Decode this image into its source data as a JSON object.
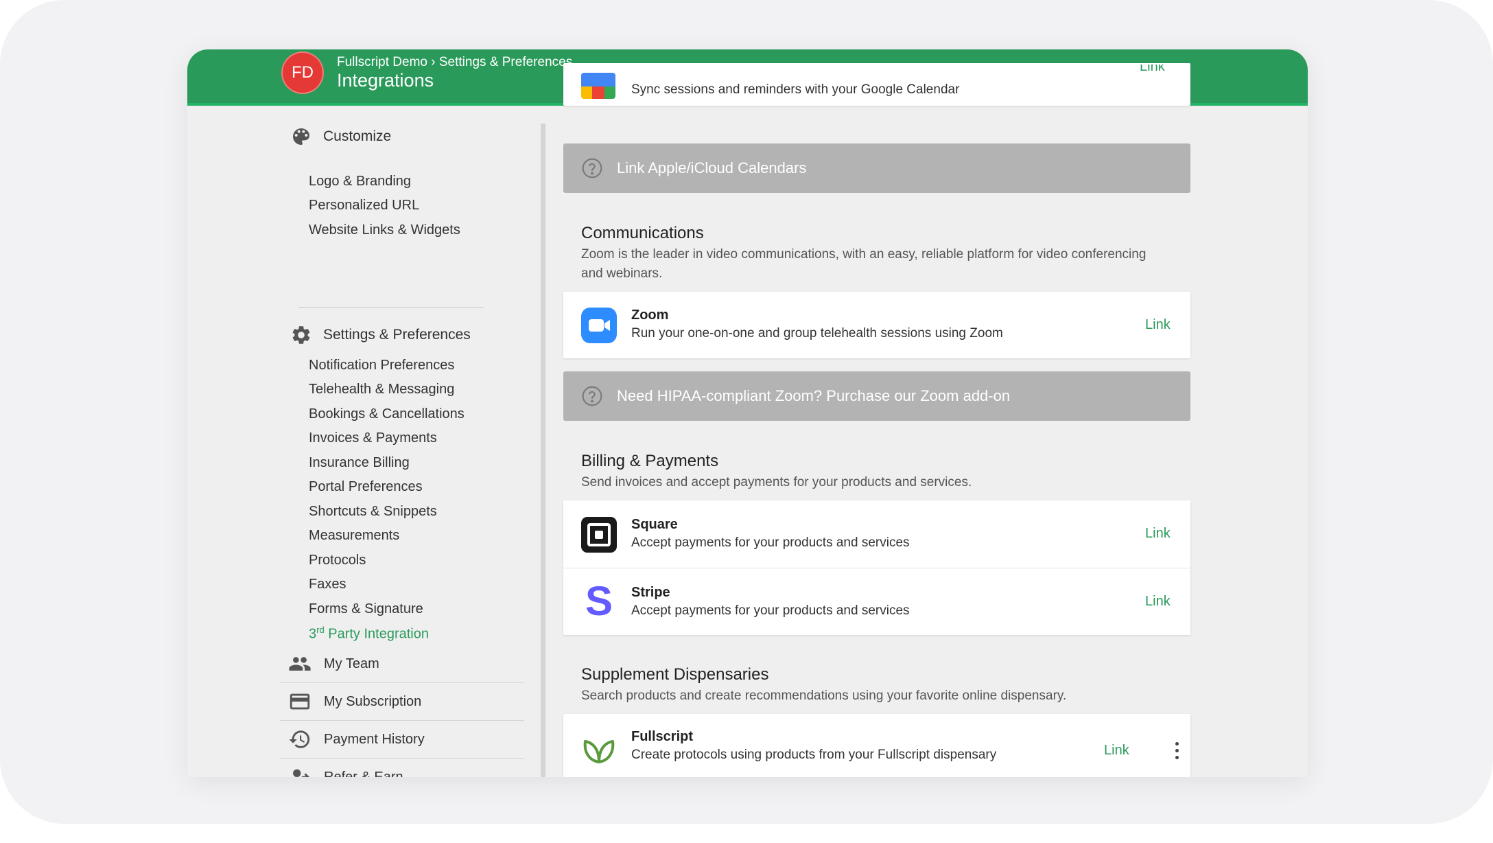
{
  "header": {
    "avatar_initials": "FD",
    "breadcrumb_org": "Fullscript Demo",
    "breadcrumb_sep": " › ",
    "breadcrumb_section": "Settings & Preferences",
    "title": "Integrations"
  },
  "sidebar": {
    "customize": {
      "label": "Customize",
      "items": [
        "Logo & Branding",
        "Personalized URL",
        "Website Links & Widgets"
      ]
    },
    "settings": {
      "label": "Settings & Preferences",
      "items": [
        "Notification Preferences",
        "Telehealth & Messaging",
        "Bookings & Cancellations",
        "Invoices & Payments",
        "Insurance Billing",
        "Portal Preferences",
        "Shortcuts & Snippets",
        "Measurements",
        "Protocols",
        "Faxes",
        "Forms & Signature"
      ],
      "active_prefix": "3",
      "active_sup": "rd",
      "active_rest": " Party Integration"
    },
    "bottom": {
      "team": "My Team",
      "subscription": "My Subscription",
      "payment_history": "Payment History",
      "refer": "Refer & Earn"
    }
  },
  "main": {
    "google": {
      "desc": "Sync sessions and reminders with your Google Calendar",
      "link": "Link"
    },
    "apple_banner": "Link Apple/iCloud Calendars",
    "communications": {
      "title": "Communications",
      "desc": "Zoom is the leader in video communications, with an easy, reliable platform for video conferencing and webinars."
    },
    "zoom": {
      "name": "Zoom",
      "desc": "Run your one-on-one and group telehealth sessions using Zoom",
      "link": "Link"
    },
    "hipaa_banner": "Need HIPAA-compliant Zoom? Purchase our Zoom add-on",
    "billing": {
      "title": "Billing & Payments",
      "desc": "Send invoices and accept payments for your products and services."
    },
    "square": {
      "name": "Square",
      "desc": "Accept payments for your products and services",
      "link": "Link"
    },
    "stripe": {
      "name": "Stripe",
      "desc": "Accept payments for your products and services",
      "link": "Link",
      "logo_letter": "S"
    },
    "supplements": {
      "title": "Supplement Dispensaries",
      "desc": "Search products and create recommendations using your favorite online dispensary."
    },
    "fullscript": {
      "name": "Fullscript",
      "desc": "Create protocols using products from your Fullscript dispensary",
      "link": "Link"
    }
  },
  "colors": {
    "brand_green": "#2a9a5b",
    "avatar_red": "#e53935",
    "banner_gray": "#b3b3b3",
    "zoom_blue": "#2d8cff",
    "stripe_indigo": "#635bff"
  }
}
